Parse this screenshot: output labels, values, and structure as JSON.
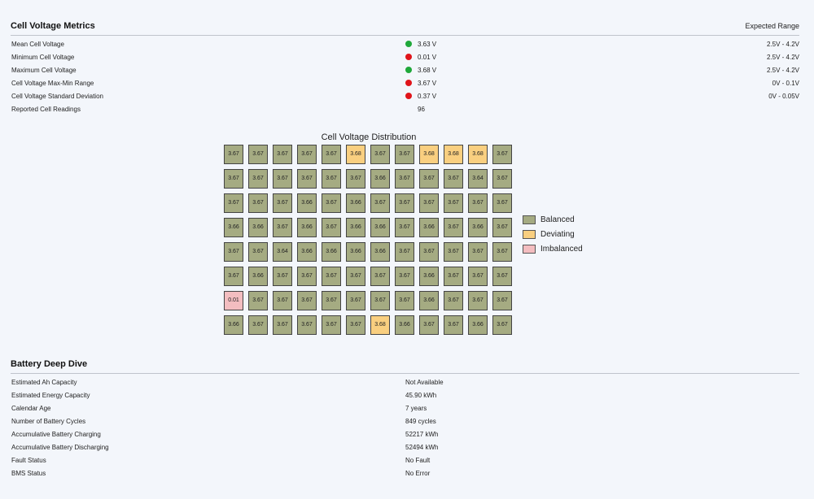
{
  "metrics": {
    "title": "Cell Voltage Metrics",
    "range_header": "Expected Range",
    "rows": [
      {
        "label": "Mean Cell Voltage",
        "value": "3.63 V",
        "status": "ok",
        "range": "2.5V - 4.2V"
      },
      {
        "label": "Minimum Cell Voltage",
        "value": "0.01 V",
        "status": "bad",
        "range": "2.5V - 4.2V"
      },
      {
        "label": "Maximum Cell Voltage",
        "value": "3.68 V",
        "status": "ok",
        "range": "2.5V - 4.2V"
      },
      {
        "label": "Cell Voltage Max-Min Range",
        "value": "3.67 V",
        "status": "bad",
        "range": "0V - 0.1V"
      },
      {
        "label": "Cell Voltage Standard Deviation",
        "value": "0.37 V",
        "status": "bad",
        "range": "0V - 0.05V"
      },
      {
        "label": "Reported Cell Readings",
        "value": "96",
        "status": "none",
        "range": ""
      }
    ]
  },
  "status_colors": {
    "ok": "#1fa83a",
    "bad": "#e0141a"
  },
  "distribution": {
    "title": "Cell Voltage Distribution",
    "cells": [
      [
        "3.67",
        "3.67",
        "3.67",
        "3.67",
        "3.67",
        "3.68",
        "3.67",
        "3.67",
        "3.68",
        "3.68",
        "3.68",
        "3.67"
      ],
      [
        "3.67",
        "3.67",
        "3.67",
        "3.67",
        "3.67",
        "3.67",
        "3.66",
        "3.67",
        "3.67",
        "3.67",
        "3.64",
        "3.67"
      ],
      [
        "3.67",
        "3.67",
        "3.67",
        "3.66",
        "3.67",
        "3.66",
        "3.67",
        "3.67",
        "3.67",
        "3.67",
        "3.67",
        "3.67"
      ],
      [
        "3.66",
        "3.66",
        "3.67",
        "3.66",
        "3.67",
        "3.66",
        "3.66",
        "3.67",
        "3.66",
        "3.67",
        "3.66",
        "3.67"
      ],
      [
        "3.67",
        "3.67",
        "3.64",
        "3.66",
        "3.66",
        "3.66",
        "3.66",
        "3.67",
        "3.67",
        "3.67",
        "3.67",
        "3.67"
      ],
      [
        "3.67",
        "3.66",
        "3.67",
        "3.67",
        "3.67",
        "3.67",
        "3.67",
        "3.67",
        "3.66",
        "3.67",
        "3.67",
        "3.67"
      ],
      [
        "0.01",
        "3.67",
        "3.67",
        "3.67",
        "3.67",
        "3.67",
        "3.67",
        "3.67",
        "3.66",
        "3.67",
        "3.67",
        "3.67"
      ],
      [
        "3.66",
        "3.67",
        "3.67",
        "3.67",
        "3.67",
        "3.67",
        "3.68",
        "3.66",
        "3.67",
        "3.67",
        "3.66",
        "3.67"
      ]
    ],
    "states": [
      [
        "b",
        "b",
        "b",
        "b",
        "b",
        "d",
        "b",
        "b",
        "d",
        "d",
        "d",
        "b"
      ],
      [
        "b",
        "b",
        "b",
        "b",
        "b",
        "b",
        "b",
        "b",
        "b",
        "b",
        "b",
        "b"
      ],
      [
        "b",
        "b",
        "b",
        "b",
        "b",
        "b",
        "b",
        "b",
        "b",
        "b",
        "b",
        "b"
      ],
      [
        "b",
        "b",
        "b",
        "b",
        "b",
        "b",
        "b",
        "b",
        "b",
        "b",
        "b",
        "b"
      ],
      [
        "b",
        "b",
        "b",
        "b",
        "b",
        "b",
        "b",
        "b",
        "b",
        "b",
        "b",
        "b"
      ],
      [
        "b",
        "b",
        "b",
        "b",
        "b",
        "b",
        "b",
        "b",
        "b",
        "b",
        "b",
        "b"
      ],
      [
        "i",
        "b",
        "b",
        "b",
        "b",
        "b",
        "b",
        "b",
        "b",
        "b",
        "b",
        "b"
      ],
      [
        "b",
        "b",
        "b",
        "b",
        "b",
        "b",
        "d",
        "b",
        "b",
        "b",
        "b",
        "b"
      ]
    ],
    "legend": [
      {
        "key": "b",
        "label": "Balanced",
        "color": "#a5ab82"
      },
      {
        "key": "d",
        "label": "Deviating",
        "color": "#f9cf80"
      },
      {
        "key": "i",
        "label": "Imbalanced",
        "color": "#f3bdc0"
      }
    ]
  },
  "deep_dive": {
    "title": "Battery Deep Dive",
    "rows": [
      {
        "label": "Estimated Ah Capacity",
        "value": "Not Available"
      },
      {
        "label": "Estimated Energy Capacity",
        "value": "45.90 kWh"
      },
      {
        "label": "Calendar Age",
        "value": "7 years"
      },
      {
        "label": "Number of Battery Cycles",
        "value": "849 cycles"
      },
      {
        "label": "Accumulative Battery Charging",
        "value": "52217 kWh"
      },
      {
        "label": "Accumulative Battery Discharging",
        "value": "52494 kWh"
      },
      {
        "label": "Fault Status",
        "value": "No Fault"
      },
      {
        "label": "BMS Status",
        "value": "No Error"
      }
    ]
  }
}
